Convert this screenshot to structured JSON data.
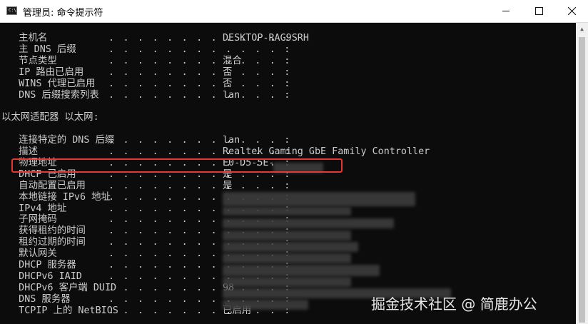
{
  "window": {
    "title": "管理员: 命令提示符"
  },
  "controls": {
    "minimize": "—",
    "maximize": "☐",
    "close": "✕"
  },
  "lines": [
    {
      "label": "   主机名",
      "value": "DESKTOP-RAG9SRH"
    },
    {
      "label": "   主 DNS 后缀",
      "value": ""
    },
    {
      "label": "   节点类型",
      "value": "混合"
    },
    {
      "label": "   IP 路由已启用",
      "value": "否"
    },
    {
      "label": "   WINS 代理已启用",
      "value": "否"
    },
    {
      "label": "   DNS 后缀搜索列表",
      "value": "lan"
    },
    {
      "label": "",
      "value": ""
    },
    {
      "label": "以太网适配器 以太网:",
      "value": ""
    },
    {
      "label": "",
      "value": ""
    },
    {
      "label": "   连接特定的 DNS 后缀",
      "value": "lan"
    },
    {
      "label": "   描述",
      "value": "Realtek Gaming GbE Family Controller"
    },
    {
      "label": "   物理地址",
      "value": "E0-D5-5E-"
    },
    {
      "label": "   DHCP 已启用",
      "value": "是"
    },
    {
      "label": "   自动配置已启用",
      "value": "是"
    },
    {
      "label": "   本地链接 IPv6 地址",
      "value": ""
    },
    {
      "label": "   IPv4 地址",
      "value": ""
    },
    {
      "label": "   子网掩码",
      "value": ""
    },
    {
      "label": "   获得租约的时间",
      "value": ""
    },
    {
      "label": "   租约过期的时间",
      "value": ""
    },
    {
      "label": "   默认网关",
      "value": ""
    },
    {
      "label": "   DHCP 服务器",
      "value": ""
    },
    {
      "label": "   DHCPv6 IAID",
      "value": ""
    },
    {
      "label": "   DHCPv6 客户端 DUID",
      "value": "98"
    },
    {
      "label": "   DNS 服务器",
      "value": ""
    },
    {
      "label": "   TCPIP 上的 NetBIOS",
      "value": "已启用"
    }
  ],
  "watermark": "掘金技术社区 @ 简鹿办公"
}
